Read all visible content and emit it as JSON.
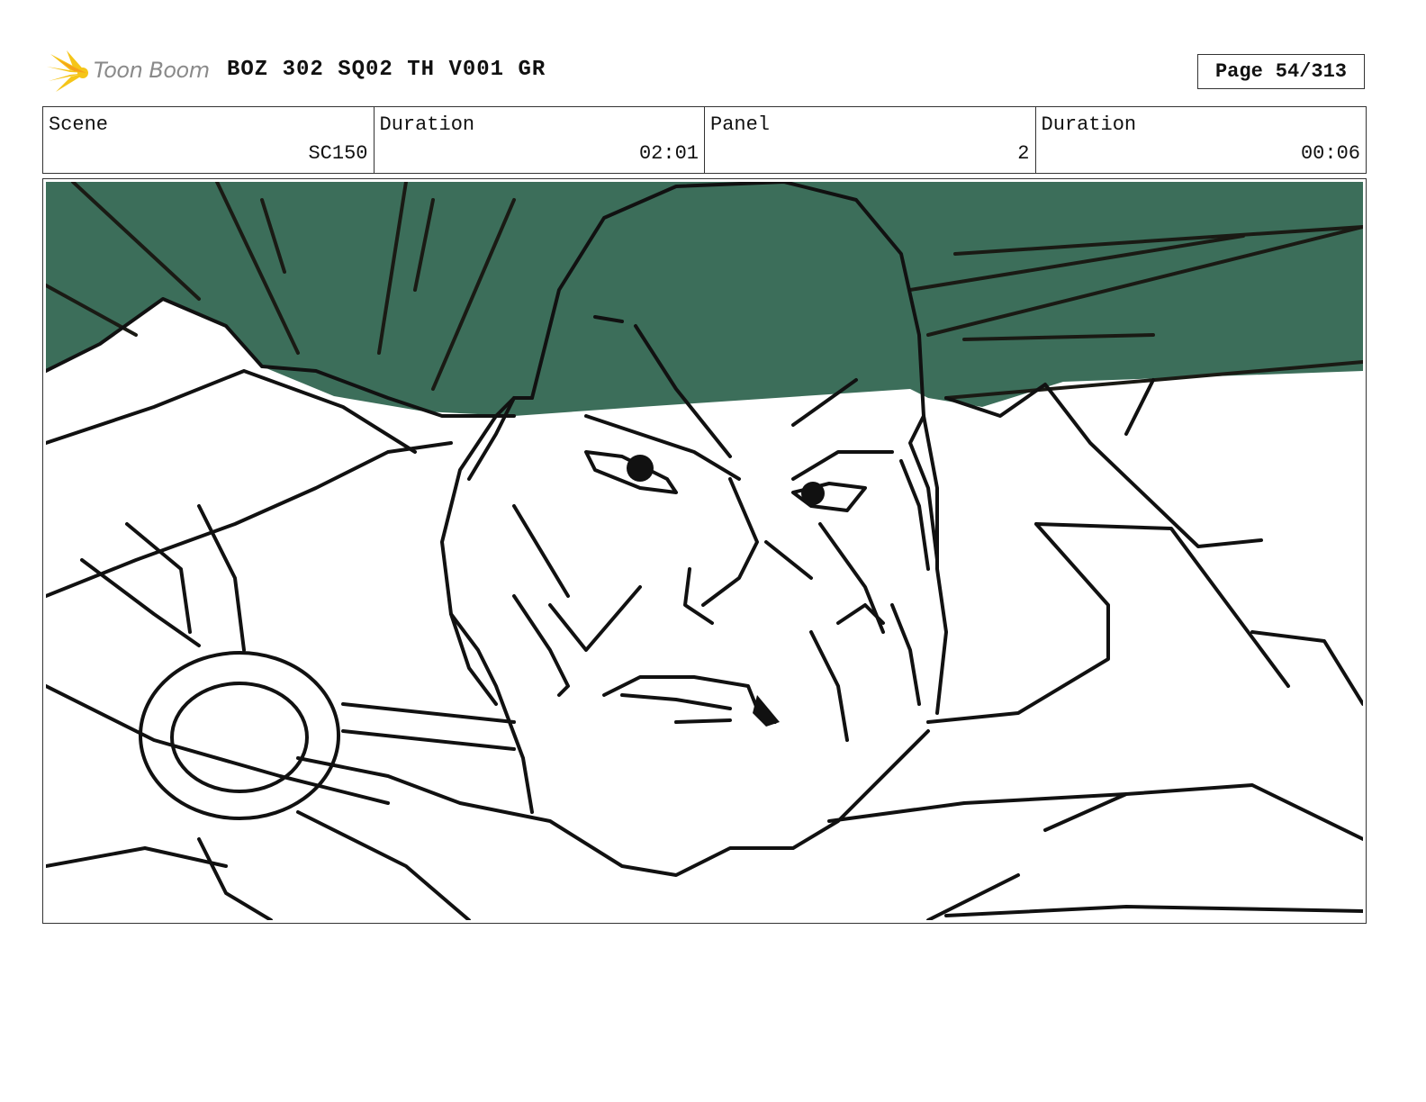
{
  "brand": {
    "name": "Toon Boom",
    "colors": {
      "flare": "#f5c518",
      "text": "#8a8a8a"
    }
  },
  "document": {
    "title": "BOZ 302 SQ02 TH V001 GR"
  },
  "page": {
    "label": "Page",
    "number": "54/313"
  },
  "info": [
    {
      "label": "Scene",
      "value": "SC150"
    },
    {
      "label": "Duration",
      "value": "02:01"
    },
    {
      "label": "Panel",
      "value": "2"
    },
    {
      "label": "Duration",
      "value": "00:06"
    }
  ],
  "panel": {
    "background_color": "#3c6e5a",
    "line_color": "#111111"
  }
}
